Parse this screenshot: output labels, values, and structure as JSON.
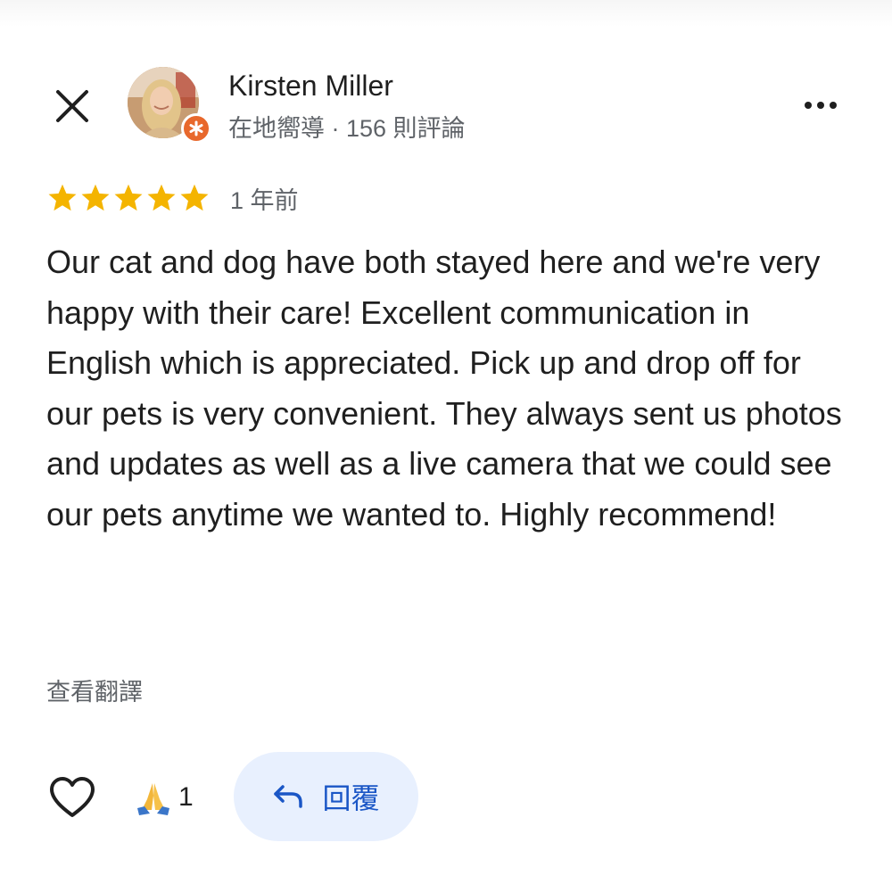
{
  "header": {
    "close_icon": "close-icon",
    "more_icon": "more-horizontal-icon"
  },
  "author": {
    "name": "Kirsten Miller",
    "meta": "在地嚮導 · 156 則評論",
    "badge_icon": "local-guide-star-icon"
  },
  "review": {
    "rating": 5,
    "rating_max": 5,
    "star_color": "#f4b400",
    "time": "1 年前",
    "text": "Our cat and dog have both stayed here and we're very happy with their care! Excellent communication in English which is appreciated. Pick up and drop off for our pets is very convenient. They always sent us photos and updates as well as a live camera that we could see our pets anytime we wanted to. Highly recommend!",
    "translate_label": "查看翻譯"
  },
  "actions": {
    "like_icon": "heart-outline-icon",
    "reaction_icon": "folded-hands-emoji",
    "reaction_count": "1",
    "reply_icon": "reply-arrow-icon",
    "reply_label": "回覆",
    "reply_bg": "#e8f0fe",
    "reply_color": "#1a56c6"
  }
}
